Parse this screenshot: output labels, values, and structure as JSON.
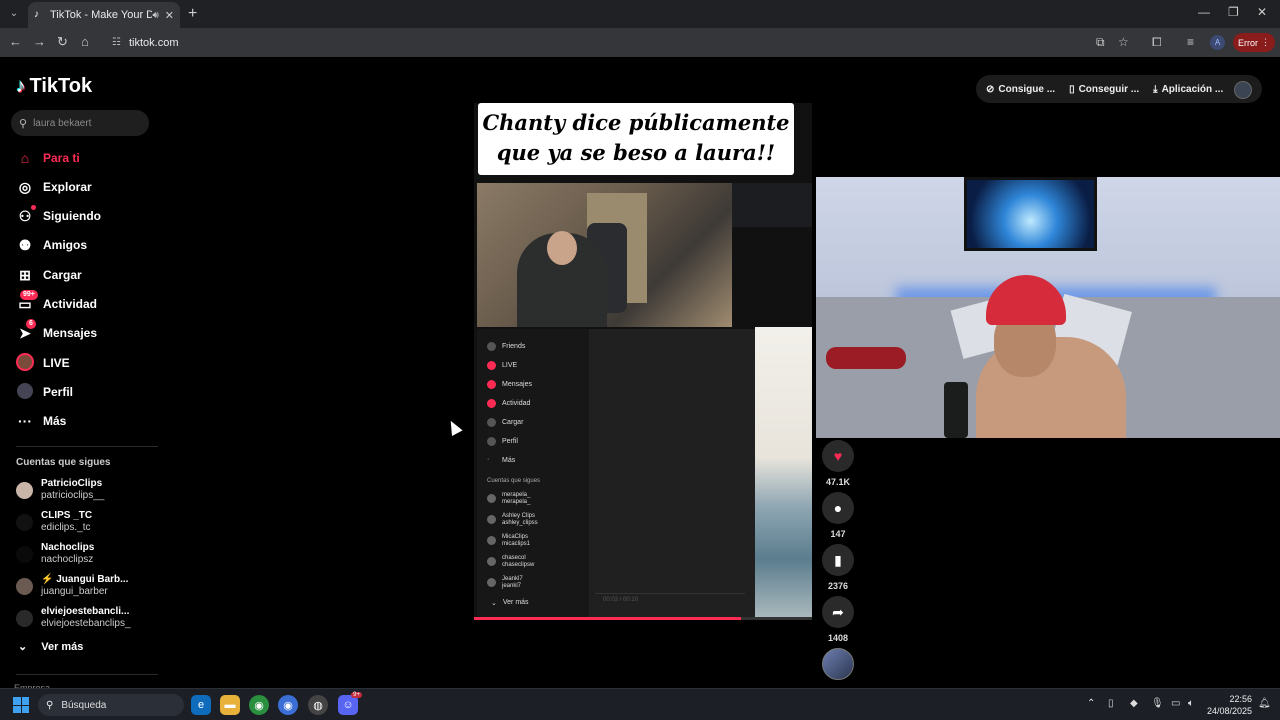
{
  "browser": {
    "tab_title": "TikTok - Make Your Day",
    "url": "tiktok.com",
    "error_label": "Error"
  },
  "sidebar": {
    "logo": "TikTok",
    "search_placeholder": "laura bekaert",
    "nav": [
      {
        "label": "Para ti",
        "icon": "home-icon",
        "active": true
      },
      {
        "label": "Explorar",
        "icon": "compass-icon"
      },
      {
        "label": "Siguiendo",
        "icon": "following-icon"
      },
      {
        "label": "Amigos",
        "icon": "friends-icon"
      },
      {
        "label": "Cargar",
        "icon": "upload-icon"
      },
      {
        "label": "Actividad",
        "icon": "activity-icon",
        "badge": "99+"
      },
      {
        "label": "Mensajes",
        "icon": "messages-icon",
        "badge": "6"
      },
      {
        "label": "LIVE",
        "icon": "live-icon"
      },
      {
        "label": "Perfil",
        "icon": "profile-icon"
      },
      {
        "label": "Más",
        "icon": "more-icon"
      }
    ],
    "following_title": "Cuentas que sigues",
    "accounts": [
      {
        "name": "PatricioClips",
        "handle": "patricioclips__"
      },
      {
        "name": "CLIPS _TC",
        "handle": "ediclips._tc"
      },
      {
        "name": "Nachoclips",
        "handle": "nachoclipsz"
      },
      {
        "name": "⚡ Juangui Barb...",
        "handle": "juangui_barber"
      },
      {
        "name": "elviejoestebancli...",
        "handle": "elviejoestebanclips_"
      }
    ],
    "see_more": "Ver más",
    "cut_text": "Empresa"
  },
  "header": {
    "pill1": "Consigue ...",
    "pill2": "Conseguir ...",
    "pill3": "Aplicación ..."
  },
  "video": {
    "caption_line1": "Chanty dice públicamente",
    "caption_line2": "que ya se beso a laura!!",
    "progress": 0.79,
    "inner_nav": [
      "Friends",
      "LIVE",
      "Mensajes",
      "Actividad",
      "Cargar",
      "Perfil",
      "Más"
    ],
    "inner_following_title": "Cuentas que sigues",
    "inner_accounts": [
      {
        "name": "merapela_",
        "handle": "merapela_"
      },
      {
        "name": "Ashley Clips",
        "handle": "ashley_clipss"
      },
      {
        "name": "MicaClips",
        "handle": "micaclips1"
      },
      {
        "name": "chasecol",
        "handle": "chaseclipsw"
      },
      {
        "name": "Jeankl7",
        "handle": "jeankl7"
      }
    ],
    "inner_see_more": "Ver más",
    "inner_bar_text": "00:03 / 00:10"
  },
  "actions": {
    "likes": "47.1K",
    "comments": "147",
    "saves": "2376",
    "shares": "1408"
  },
  "taskbar": {
    "search_label": "Búsqueda",
    "time": "22:56",
    "date": "24/08/2025",
    "discord_badge": "9+"
  },
  "colors": {
    "accent": "#fe2c55",
    "background": "#000000"
  }
}
